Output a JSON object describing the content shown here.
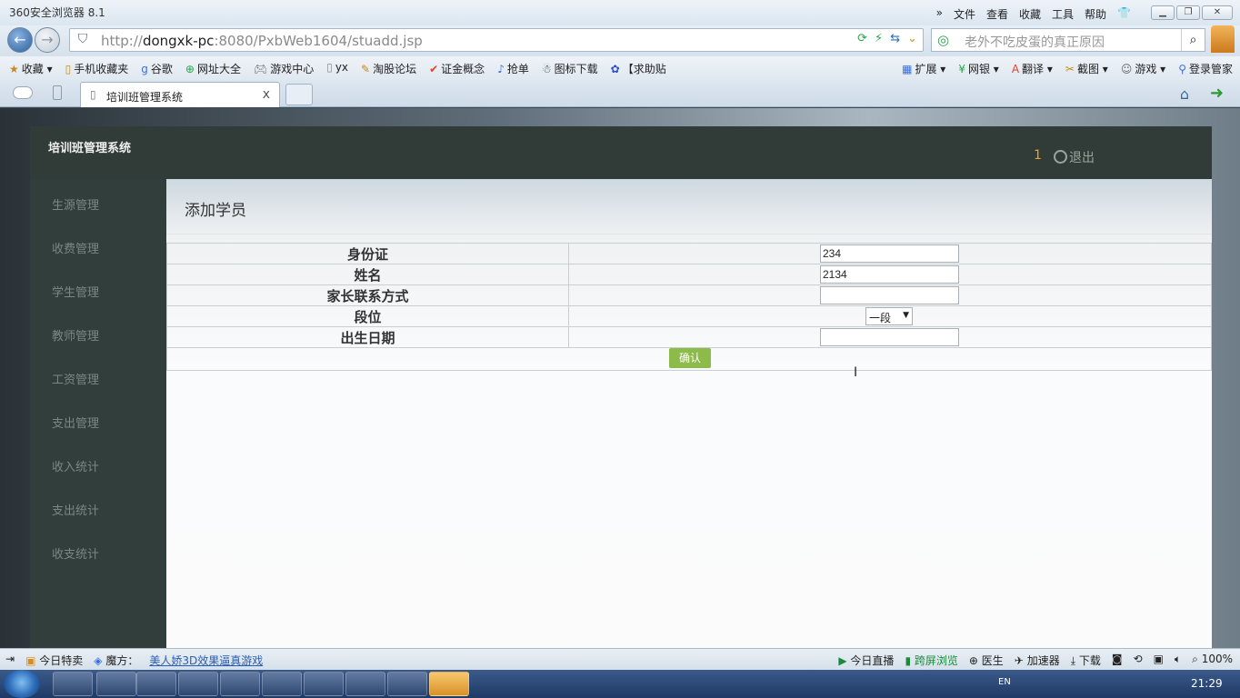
{
  "browser": {
    "app_title": "360安全浏览器 8.1",
    "menus": [
      "文件",
      "查看",
      "收藏",
      "工具",
      "帮助"
    ],
    "url_host": "http://",
    "url_domain": "dongxk-pc",
    "url_rest": ":8080/PxbWeb1604/stuadd.jsp",
    "search_placeholder": "老外不吃皮蛋的真正原因",
    "favorites_left": [
      "收藏",
      "手机收藏夹",
      "谷歌",
      "网址大全",
      "游戏中心",
      "yx",
      "淘股论坛",
      "证金概念",
      "抢单",
      "图标下载",
      "【求助贴"
    ],
    "favorites_right": [
      "扩展",
      "网银",
      "翻译",
      "截图",
      "游戏",
      "登录管家"
    ],
    "tab_title": "培训班管理系统",
    "tab_close": "x"
  },
  "app": {
    "brand": "培训班管理系统",
    "user_count": "1",
    "logout": "退出",
    "sidebar": [
      "生源管理",
      "收费管理",
      "学生管理",
      "教师管理",
      "工资管理",
      "支出管理",
      "收入统计",
      "支出统计",
      "收支统计"
    ],
    "page_title": "添加学员",
    "form": {
      "id_label": "身份证",
      "id_value": "234",
      "name_label": "姓名",
      "name_value": "2134",
      "contact_label": "家长联系方式",
      "contact_value": "",
      "level_label": "段位",
      "level_value": "一段",
      "birth_label": "出生日期",
      "birth_value": "",
      "submit_label": "确认"
    }
  },
  "statusbar": {
    "left": [
      "今日特卖",
      "魔方："
    ],
    "promo_link": "美人娇3D效果逼真游戏",
    "right": [
      "今日直播",
      "跨屏浏览",
      "医生",
      "加速器",
      "下载"
    ],
    "zoom": "100%"
  },
  "taskbar": {
    "lang": "EN",
    "clock": "21:29"
  }
}
